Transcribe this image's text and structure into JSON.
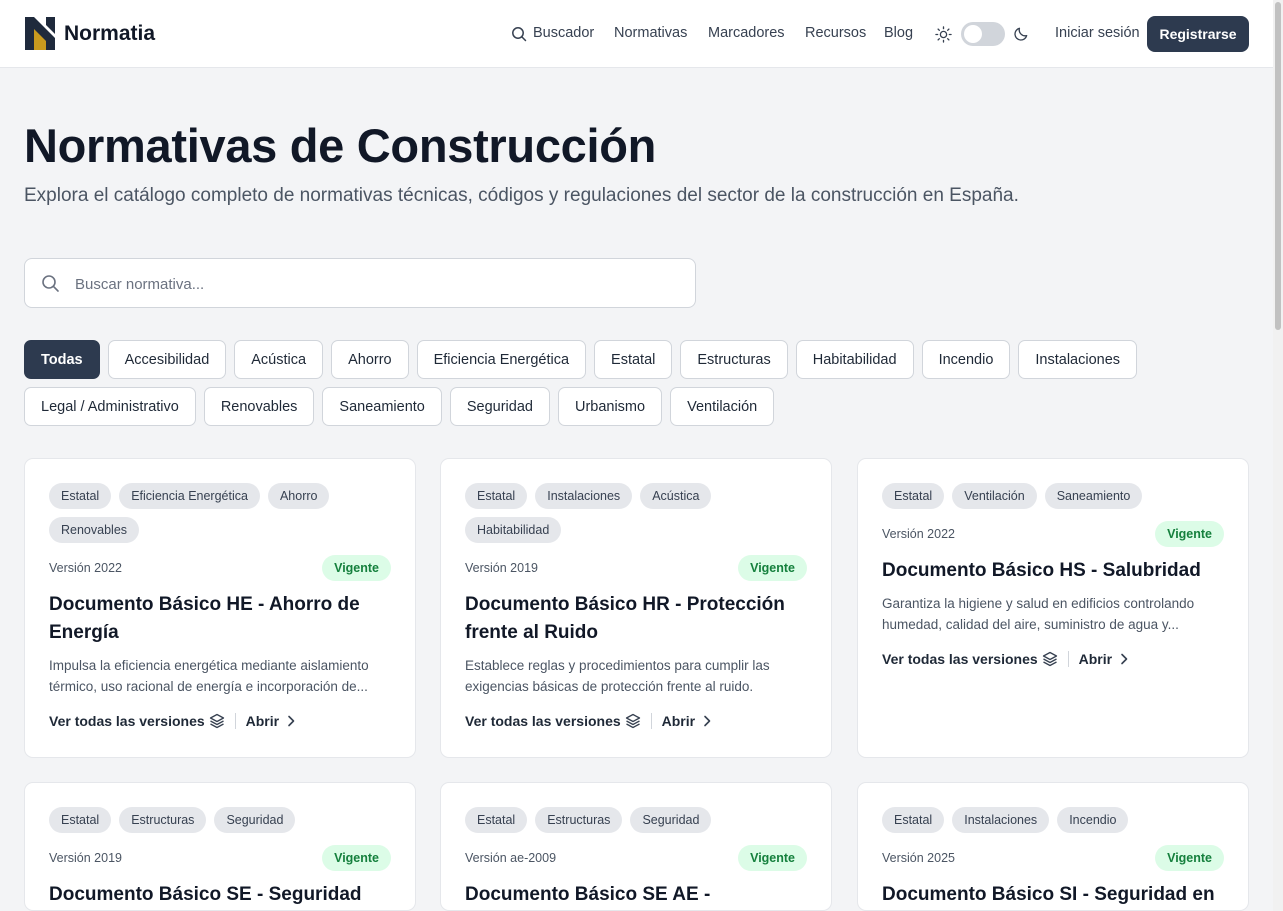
{
  "header": {
    "brand": "Normatia",
    "nav": [
      "Buscador",
      "Normativas",
      "Marcadores",
      "Recursos",
      "Blog"
    ],
    "login": "Iniciar sesión",
    "register": "Registrarse",
    "theme_toggle_dark": false
  },
  "hero": {
    "title": "Normativas de Construcción",
    "subtitle": "Explora el catálogo completo de normativas técnicas, códigos y regulaciones del sector de la construcción en España.",
    "search_placeholder": "Buscar normativa..."
  },
  "filters": {
    "row1": [
      "Todas",
      "Accesibilidad",
      "Acústica",
      "Ahorro",
      "Eficiencia Energética",
      "Estatal",
      "Estructuras",
      "Habitabilidad",
      "Incendio",
      "Instalaciones"
    ],
    "row2": [
      "Legal / Administrativo",
      "Renovables",
      "Saneamiento",
      "Seguridad",
      "Urbanismo",
      "Ventilación"
    ],
    "active": "Todas"
  },
  "cards": [
    {
      "tags": [
        "Estatal",
        "Eficiencia Energética",
        "Ahorro",
        "Renovables"
      ],
      "version": "Versión 2022",
      "status": "Vigente",
      "title": "Documento Básico HE - Ahorro de Energía",
      "description": "Impulsa la eficiencia energética mediante aislamiento térmico, uso racional de energía e incorporación de...",
      "versions_link": "Ver todas las versiones",
      "open_link": "Abrir"
    },
    {
      "tags": [
        "Estatal",
        "Instalaciones",
        "Acústica",
        "Habitabilidad"
      ],
      "version": "Versión 2019",
      "status": "Vigente",
      "title": "Documento Básico HR - Protección frente al Ruido",
      "description": "Establece reglas y procedimientos para cumplir las exigencias básicas de protección frente al ruido.",
      "versions_link": "Ver todas las versiones",
      "open_link": "Abrir"
    },
    {
      "tags": [
        "Estatal",
        "Ventilación",
        "Saneamiento"
      ],
      "version": "Versión 2022",
      "status": "Vigente",
      "title": "Documento Básico HS - Salubridad",
      "description": "Garantiza la higiene y salud en edificios controlando humedad, calidad del aire, suministro de agua y...",
      "versions_link": "Ver todas las versiones",
      "open_link": "Abrir"
    },
    {
      "tags": [
        "Estatal",
        "Estructuras",
        "Seguridad"
      ],
      "version": "Versión 2019",
      "status": "Vigente",
      "title": "Documento Básico SE - Seguridad",
      "description": "",
      "versions_link": "",
      "open_link": ""
    },
    {
      "tags": [
        "Estatal",
        "Estructuras",
        "Seguridad"
      ],
      "version": "Versión ae-2009",
      "status": "Vigente",
      "title": "Documento Básico SE AE - Seguridad",
      "description": "",
      "versions_link": "",
      "open_link": ""
    },
    {
      "tags": [
        "Estatal",
        "Instalaciones",
        "Incendio"
      ],
      "version": "Versión 2025",
      "status": "Vigente",
      "title": "Documento Básico SI - Seguridad en caso",
      "description": "",
      "versions_link": "",
      "open_link": ""
    }
  ]
}
